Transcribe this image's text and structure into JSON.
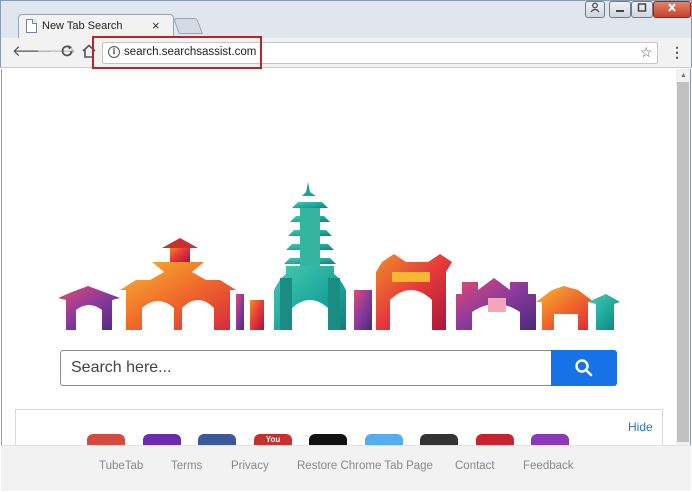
{
  "browser": {
    "tab_title": "New Tab Search",
    "tab_close": "×",
    "url": "search.searchsassist.com",
    "window_buttons": {
      "minimize": "▁",
      "maximize": "▢",
      "close": "✕",
      "user": "👤"
    }
  },
  "search": {
    "placeholder": "Search here..."
  },
  "apps_panel": {
    "hide_label": "Hide",
    "apps": [
      {
        "name": "gmail",
        "label": "",
        "color": "#d44b3e"
      },
      {
        "name": "yahoo",
        "label": "",
        "color": "#6a2cae"
      },
      {
        "name": "facebook",
        "label": "",
        "color": "#3b5998"
      },
      {
        "name": "youtube",
        "label": "You",
        "color": "#c9302c"
      },
      {
        "name": "amazon",
        "label": "",
        "color": "#111111"
      },
      {
        "name": "twitter",
        "label": "",
        "color": "#55acee"
      },
      {
        "name": "wikipedia",
        "label": "",
        "color": "#333333"
      },
      {
        "name": "pinterest",
        "label": "",
        "color": "#c8232c"
      },
      {
        "name": "instagram",
        "label": "",
        "color": "#8a3ab9"
      }
    ]
  },
  "footer": {
    "links": [
      "TubeTab",
      "Terms",
      "Privacy",
      "Restore Chrome Tab Page",
      "Contact",
      "Feedback"
    ]
  },
  "colors": {
    "accent": "#1672e6",
    "highlight_box": "#b3262d"
  }
}
